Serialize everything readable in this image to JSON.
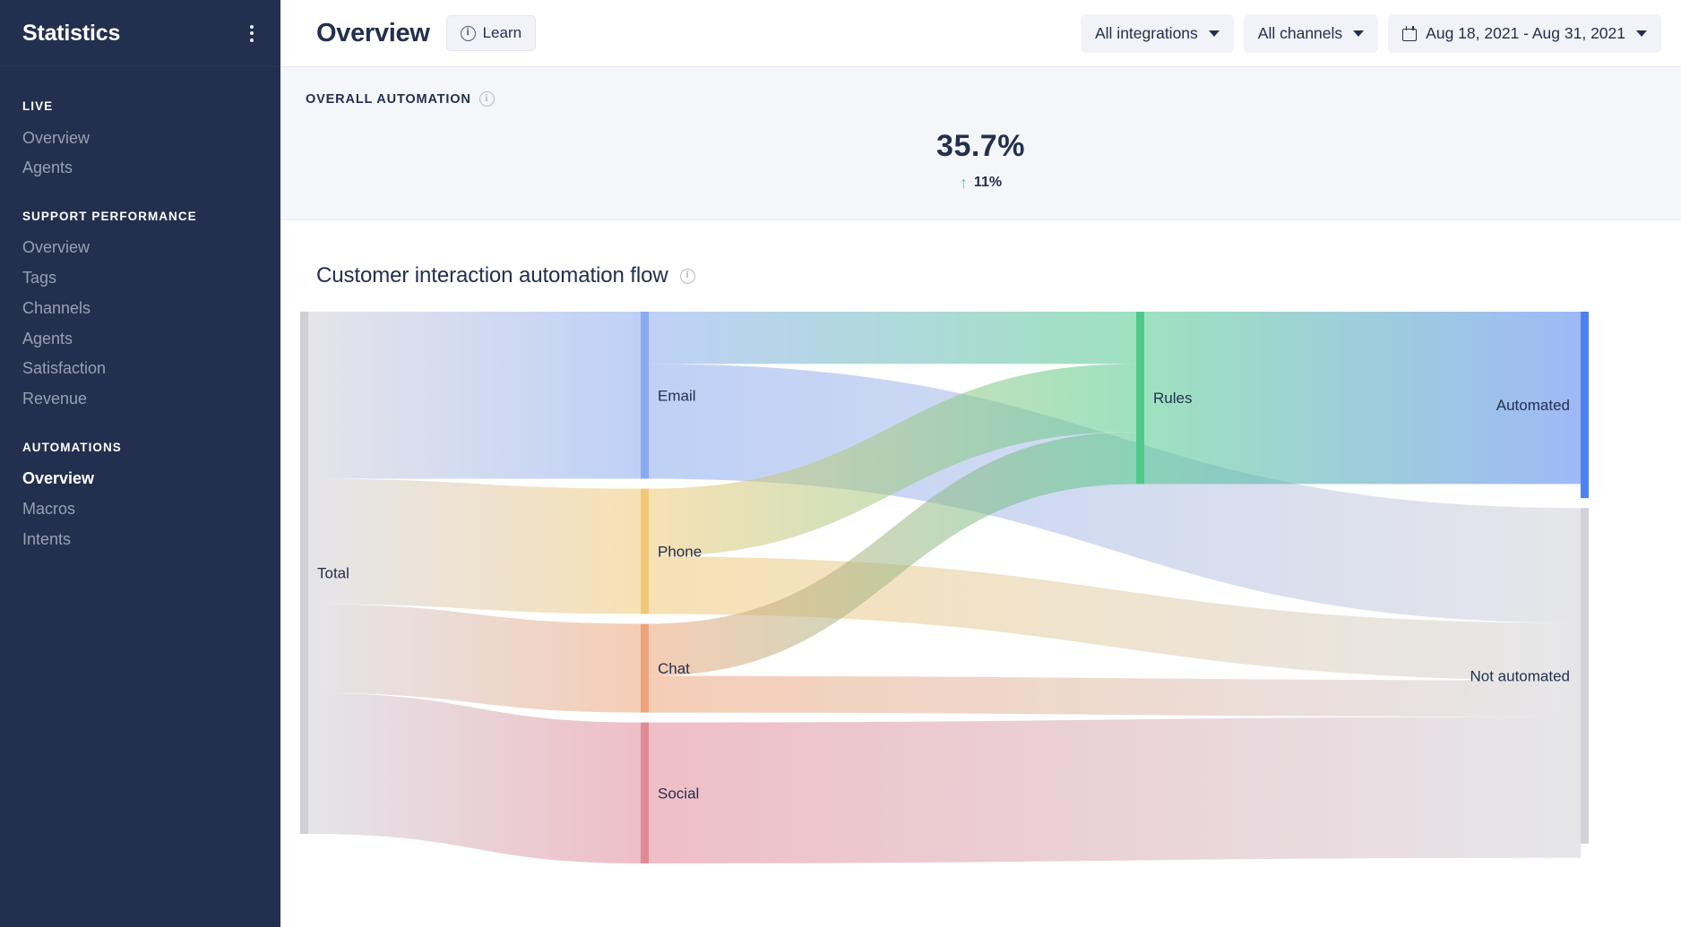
{
  "sidebar": {
    "title": "Statistics",
    "menu_icon": "kebab-menu-icon",
    "groups": [
      {
        "title": "LIVE",
        "items": [
          {
            "label": "Overview",
            "active": false
          },
          {
            "label": "Agents",
            "active": false
          }
        ]
      },
      {
        "title": "SUPPORT PERFORMANCE",
        "items": [
          {
            "label": "Overview",
            "active": false
          },
          {
            "label": "Tags",
            "active": false
          },
          {
            "label": "Channels",
            "active": false
          },
          {
            "label": "Agents",
            "active": false
          },
          {
            "label": "Satisfaction",
            "active": false
          },
          {
            "label": "Revenue",
            "active": false
          }
        ]
      },
      {
        "title": "AUTOMATIONS",
        "items": [
          {
            "label": "Overview",
            "active": true
          },
          {
            "label": "Macros",
            "active": false
          },
          {
            "label": "Intents",
            "active": false
          }
        ]
      }
    ]
  },
  "topbar": {
    "page_title": "Overview",
    "learn_label": "Learn",
    "learn_icon": "info-icon",
    "integrations_filter": "All integrations",
    "channels_filter": "All channels",
    "date_range": "Aug 18, 2021 - Aug 31, 2021",
    "calendar_icon": "calendar-icon",
    "caret_icon": "chevron-down-icon"
  },
  "kpi": {
    "label": "OVERALL AUTOMATION",
    "info_icon": "info-icon",
    "value": "35.7%",
    "delta": "11%",
    "delta_direction": "up",
    "delta_color": "#4cd08a"
  },
  "chart": {
    "title": "Customer interaction automation flow",
    "info_icon": "info-icon"
  },
  "chart_data": {
    "type": "sankey",
    "title": "Customer interaction automation flow",
    "nodes": [
      {
        "id": "total",
        "label": "Total",
        "column": 0,
        "value": 100,
        "color": "#cfcfd8"
      },
      {
        "id": "email",
        "label": "Email",
        "column": 1,
        "value": 32,
        "color": "#8aaaf0"
      },
      {
        "id": "phone",
        "label": "Phone",
        "column": 1,
        "value": 24,
        "color": "#f0c878"
      },
      {
        "id": "chat",
        "label": "Chat",
        "column": 1,
        "value": 17,
        "color": "#eda47a"
      },
      {
        "id": "social",
        "label": "Social",
        "column": 1,
        "value": 27,
        "color": "#e08a96"
      },
      {
        "id": "rules",
        "label": "Rules",
        "column": 2,
        "value": 33,
        "color": "#4fc98a"
      },
      {
        "id": "automated",
        "label": "Automated",
        "column": 3,
        "value": 35.7,
        "color": "#4f80f0"
      },
      {
        "id": "notautomated",
        "label": "Not automated",
        "column": 3,
        "value": 64.3,
        "color": "#d2d2d8"
      }
    ],
    "links": [
      {
        "source": "total",
        "target": "email",
        "value": 32
      },
      {
        "source": "total",
        "target": "phone",
        "value": 24
      },
      {
        "source": "total",
        "target": "chat",
        "value": 17
      },
      {
        "source": "total",
        "target": "social",
        "value": 27
      },
      {
        "source": "email",
        "target": "rules",
        "value": 10
      },
      {
        "source": "email",
        "target": "notautomated",
        "value": 22
      },
      {
        "source": "phone",
        "target": "rules",
        "value": 13
      },
      {
        "source": "phone",
        "target": "notautomated",
        "value": 11
      },
      {
        "source": "chat",
        "target": "rules",
        "value": 10
      },
      {
        "source": "chat",
        "target": "notautomated",
        "value": 7
      },
      {
        "source": "social",
        "target": "notautomated",
        "value": 27
      },
      {
        "source": "rules",
        "target": "automated",
        "value": 33
      }
    ],
    "legend": null,
    "grid": false
  }
}
